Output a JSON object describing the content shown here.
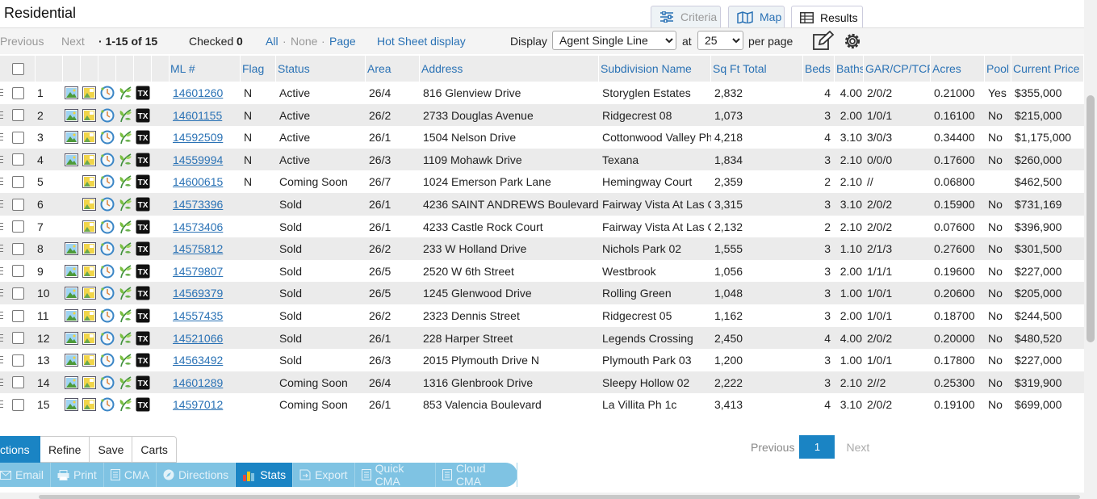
{
  "title": "Residential",
  "view_tabs": {
    "criteria": "Criteria",
    "map": "Map",
    "results": "Results"
  },
  "toolbar": {
    "previous": "Previous",
    "next": "Next",
    "range": "· 1-15 of 15",
    "checked_label": "Checked",
    "checked_count": "0",
    "all": "All",
    "sep1": "·",
    "none": "None",
    "sep2": "·",
    "page": "Page",
    "hot_sheet": "Hot Sheet display",
    "display_label": "Display",
    "display_value": "Agent Single Line",
    "at_label": "at",
    "per_page_value": "25",
    "per_page_label": "per page"
  },
  "columns": [
    "ML #",
    "Flag",
    "Status",
    "Area",
    "Address",
    "Subdivision Name",
    "Sq Ft Total",
    "Beds",
    "Baths",
    "GAR/CP/TCP",
    "Acres",
    "Pool",
    "Current Price"
  ],
  "rows": [
    {
      "n": "1",
      "photo": true,
      "mls": "14601260",
      "flag": "N",
      "status": "Active",
      "area": "26/4",
      "address": "816 Glenview Drive",
      "subdivision": "Storyglen Estates",
      "sqft": "2,832",
      "beds": "4",
      "baths": "4.00",
      "gar": "2/0/2",
      "acres": "0.21000",
      "pool": "Yes",
      "price": "$355,000"
    },
    {
      "n": "2",
      "photo": true,
      "mls": "14601155",
      "flag": "N",
      "status": "Active",
      "area": "26/2",
      "address": "2733 Douglas Avenue",
      "subdivision": "Ridgecrest 08",
      "sqft": "1,073",
      "beds": "3",
      "baths": "2.00",
      "gar": "1/0/1",
      "acres": "0.16100",
      "pool": "No",
      "price": "$215,000"
    },
    {
      "n": "3",
      "photo": true,
      "mls": "14592509",
      "flag": "N",
      "status": "Active",
      "area": "26/1",
      "address": "1504 Nelson Drive",
      "subdivision": "Cottonwood Valley Ph",
      "sqft": "4,218",
      "beds": "4",
      "baths": "3.10",
      "gar": "3/0/3",
      "acres": "0.34400",
      "pool": "No",
      "price": "$1,175,000"
    },
    {
      "n": "4",
      "photo": true,
      "mls": "14559994",
      "flag": "N",
      "status": "Active",
      "area": "26/3",
      "address": "1109 Mohawk Drive",
      "subdivision": "Texana",
      "sqft": "1,834",
      "beds": "3",
      "baths": "2.10",
      "gar": "0/0/0",
      "acres": "0.17600",
      "pool": "No",
      "price": "$260,000"
    },
    {
      "n": "5",
      "photo": false,
      "mls": "14600615",
      "flag": "N",
      "status": "Coming Soon",
      "area": "26/7",
      "address": "1024 Emerson Park Lane",
      "subdivision": "Hemingway Court",
      "sqft": "2,359",
      "beds": "2",
      "baths": "2.10",
      "gar": "//",
      "acres": "0.06800",
      "pool": "",
      "price": "$462,500"
    },
    {
      "n": "6",
      "photo": false,
      "mls": "14573396",
      "flag": "",
      "status": "Sold",
      "area": "26/1",
      "address": "4236 SAINT ANDREWS Boulevard",
      "subdivision": "Fairway Vista At Las C",
      "sqft": "3,315",
      "beds": "3",
      "baths": "3.10",
      "gar": "2/0/2",
      "acres": "0.15900",
      "pool": "No",
      "price": "$731,169"
    },
    {
      "n": "7",
      "photo": false,
      "mls": "14573406",
      "flag": "",
      "status": "Sold",
      "area": "26/1",
      "address": "4233 Castle Rock Court",
      "subdivision": "Fairway Vista At Las C",
      "sqft": "2,132",
      "beds": "2",
      "baths": "2.10",
      "gar": "2/0/2",
      "acres": "0.07600",
      "pool": "No",
      "price": "$396,900"
    },
    {
      "n": "8",
      "photo": true,
      "mls": "14575812",
      "flag": "",
      "status": "Sold",
      "area": "26/2",
      "address": "233 W Holland Drive",
      "subdivision": "Nichols Park 02",
      "sqft": "1,555",
      "beds": "3",
      "baths": "1.10",
      "gar": "2/1/3",
      "acres": "0.27600",
      "pool": "No",
      "price": "$301,500"
    },
    {
      "n": "9",
      "photo": true,
      "mls": "14579807",
      "flag": "",
      "status": "Sold",
      "area": "26/5",
      "address": "2520 W 6th Street",
      "subdivision": "Westbrook",
      "sqft": "1,056",
      "beds": "3",
      "baths": "2.00",
      "gar": "1/1/1",
      "acres": "0.19600",
      "pool": "No",
      "price": "$227,000"
    },
    {
      "n": "10",
      "photo": true,
      "mls": "14569379",
      "flag": "",
      "status": "Sold",
      "area": "26/5",
      "address": "1245 Glenwood Drive",
      "subdivision": "Rolling Green",
      "sqft": "1,048",
      "beds": "3",
      "baths": "1.00",
      "gar": "1/0/1",
      "acres": "0.20600",
      "pool": "No",
      "price": "$205,000"
    },
    {
      "n": "11",
      "photo": true,
      "mls": "14557435",
      "flag": "",
      "status": "Sold",
      "area": "26/2",
      "address": "2323 Dennis Street",
      "subdivision": "Ridgecrest 05",
      "sqft": "1,162",
      "beds": "3",
      "baths": "2.00",
      "gar": "1/0/1",
      "acres": "0.18700",
      "pool": "No",
      "price": "$244,500"
    },
    {
      "n": "12",
      "photo": true,
      "mls": "14521066",
      "flag": "",
      "status": "Sold",
      "area": "26/1",
      "address": "228 Harper Street",
      "subdivision": "Legends Crossing",
      "sqft": "2,450",
      "beds": "4",
      "baths": "4.00",
      "gar": "2/0/2",
      "acres": "0.20000",
      "pool": "No",
      "price": "$480,520"
    },
    {
      "n": "13",
      "photo": true,
      "mls": "14563492",
      "flag": "",
      "status": "Sold",
      "area": "26/3",
      "address": "2015 Plymouth Drive N",
      "subdivision": "Plymouth Park 03",
      "sqft": "1,200",
      "beds": "3",
      "baths": "1.00",
      "gar": "1/0/1",
      "acres": "0.17800",
      "pool": "No",
      "price": "$227,000"
    },
    {
      "n": "14",
      "photo": true,
      "mls": "14601289",
      "flag": "",
      "status": "Coming Soon",
      "area": "26/4",
      "address": "1316 Glenbrook Drive",
      "subdivision": "Sleepy Hollow 02",
      "sqft": "2,222",
      "beds": "3",
      "baths": "2.10",
      "gar": "2//2",
      "acres": "0.25300",
      "pool": "No",
      "price": "$319,900"
    },
    {
      "n": "15",
      "photo": true,
      "mls": "14597012",
      "flag": "",
      "status": "Coming Soon",
      "area": "26/1",
      "address": "853 Valencia Boulevard",
      "subdivision": "La Villita Ph 1c",
      "sqft": "3,413",
      "beds": "4",
      "baths": "3.10",
      "gar": "2/0/2",
      "acres": "0.19100",
      "pool": "No",
      "price": "$699,000"
    }
  ],
  "bottom_tabs": [
    "ctions",
    "Refine",
    "Save",
    "Carts"
  ],
  "pager": {
    "previous": "Previous",
    "page": "1",
    "next": "Next"
  },
  "actions": [
    {
      "label": "Email",
      "icon": "email-icon"
    },
    {
      "label": "Print",
      "icon": "print-icon"
    },
    {
      "label": "CMA",
      "icon": "cma-icon"
    },
    {
      "label": "Directions",
      "icon": "directions-icon"
    },
    {
      "label": "Stats",
      "icon": "stats-icon"
    },
    {
      "label": "Export",
      "icon": "export-icon"
    },
    {
      "label": "Quick CMA",
      "icon": "quick-cma-icon"
    },
    {
      "label": "Cloud CMA",
      "icon": "cloud-cma-icon"
    }
  ],
  "colors": {
    "accent": "#1a84c4",
    "link": "#2a72b5",
    "row_alt": "#ebebeb"
  }
}
